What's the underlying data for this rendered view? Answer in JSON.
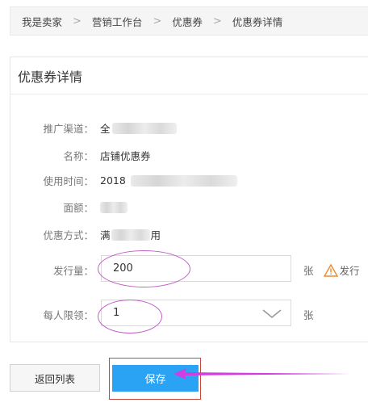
{
  "breadcrumb": {
    "items": [
      "我是卖家",
      "营销工作台",
      "优惠券",
      "优惠券详情"
    ],
    "separator": ">"
  },
  "panel": {
    "title": "优惠券详情",
    "fields": {
      "channel_label": "推广渠道：",
      "channel_value": "全",
      "name_label": "名称：",
      "name_value": "店铺优惠券",
      "time_label": "使用时间：",
      "time_value": "2018",
      "amount_label": "面额：",
      "method_label": "优惠方式：",
      "method_value_prefix": "满",
      "method_value_suffix": "用"
    },
    "quantity": {
      "label": "发行量：",
      "value": "200",
      "unit": "张",
      "warning_text": "发行"
    },
    "limit": {
      "label": "每人限领：",
      "value": "1",
      "unit": "张"
    }
  },
  "actions": {
    "back_label": "返回列表",
    "save_label": "保存"
  },
  "colors": {
    "primary": "#2aa3f4",
    "annotation_oval": "#c05fc4",
    "annotation_box": "#c9463a",
    "annotation_arrow": "#d13de0",
    "warning": "#f0882c"
  },
  "icons": {
    "separator": "chevron-right-icon",
    "select": "chevron-down-icon",
    "warning": "warning-icon"
  }
}
